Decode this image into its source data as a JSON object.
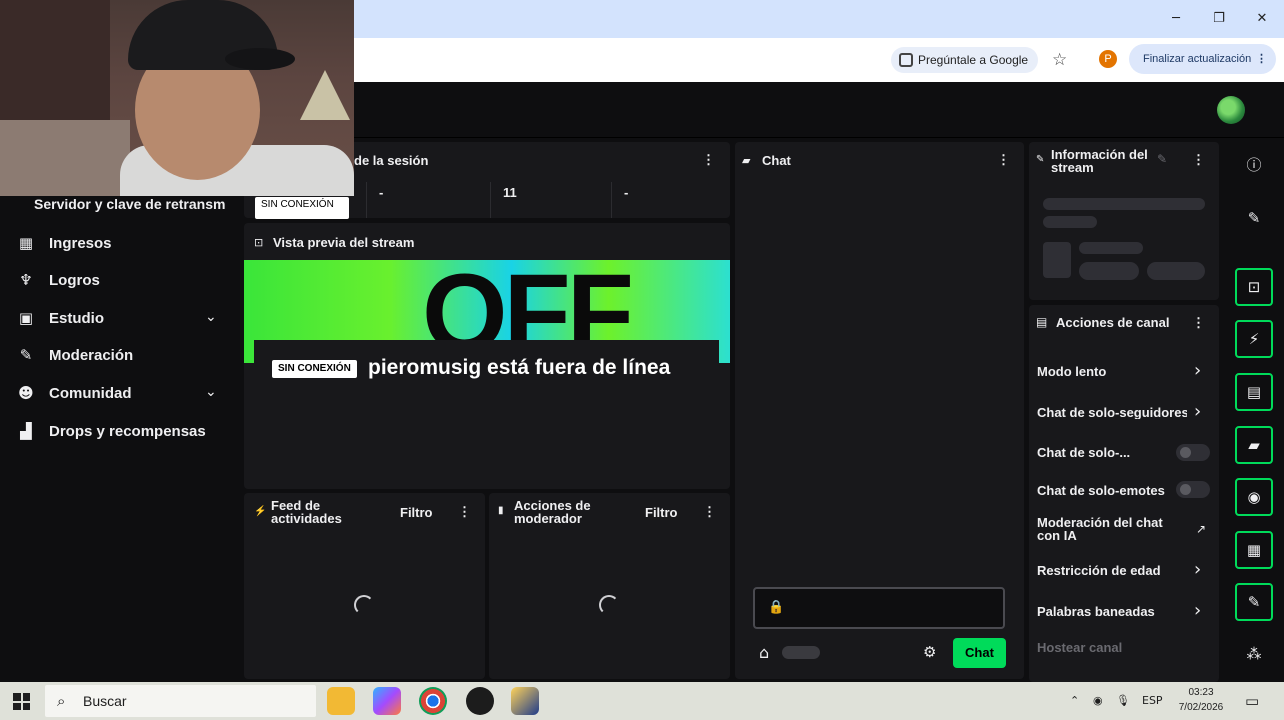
{
  "browser": {
    "ask_google": "Pregúntale a Google",
    "profile_initial": "P",
    "update_label": "Finalizar actualización",
    "win_minimize": "─",
    "win_restore": "❐",
    "win_close": "✕"
  },
  "leftnav": {
    "retransmission": "Servidor y clave de retransm",
    "items": [
      {
        "label": "Ingresos",
        "icon": "bar-chart-icon"
      },
      {
        "label": "Logros",
        "icon": "trophy-icon"
      },
      {
        "label": "Estudio",
        "icon": "film-icon",
        "expandable": true
      },
      {
        "label": "Moderación",
        "icon": "wrench-icon"
      },
      {
        "label": "Comunidad",
        "icon": "people-icon",
        "expandable": true
      },
      {
        "label": "Drops y recompensas",
        "icon": "gift-icon"
      }
    ]
  },
  "session": {
    "title": "de la sesión",
    "badge": "SIN CONEXIÓN",
    "stats": [
      "-",
      "11",
      "-"
    ]
  },
  "preview": {
    "title": "Vista previa del stream",
    "image_text": "OFF",
    "offline_badge": "SIN CONEXIÓN",
    "offline_message": "pieromusig está fuera de línea"
  },
  "feed": {
    "title": "Feed de actividades",
    "filter": "Filtro"
  },
  "modactions": {
    "title": "Acciones de moderador",
    "filter": "Filtro"
  },
  "chat": {
    "title": "Chat",
    "send": "Chat"
  },
  "stream_info": {
    "title": "Información del stream"
  },
  "channel_actions": {
    "title": "Acciones de canal",
    "items": [
      {
        "label": "Modo lento",
        "control": "chevron"
      },
      {
        "label": "Chat de solo-seguidores",
        "control": "chevron"
      },
      {
        "label": "Chat de solo-...",
        "control": "toggle"
      },
      {
        "label": "Chat de solo-emotes",
        "control": "toggle"
      },
      {
        "label": "Moderación del chat con IA",
        "control": "external"
      },
      {
        "label": "Restricción de edad",
        "control": "chevron"
      },
      {
        "label": "Palabras baneadas",
        "control": "chevron"
      },
      {
        "label": "Hostear canal",
        "control": "none"
      }
    ]
  },
  "taskbar": {
    "search": "Buscar",
    "lang": "ESP",
    "time": "03:23",
    "date": "7/02/2026"
  },
  "colors": {
    "accent": "#00db5a",
    "panel": "#18181b",
    "background": "#0e0e10",
    "chrome": "#d3e3fd"
  }
}
